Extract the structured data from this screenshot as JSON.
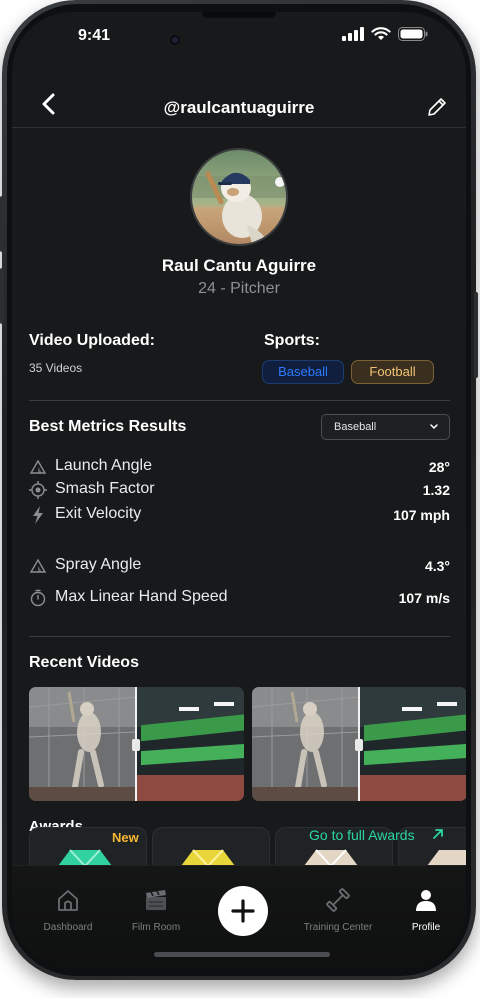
{
  "status_bar": {
    "time": "9:41"
  },
  "header": {
    "handle": "@raulcantuaguirre"
  },
  "profile": {
    "name": "Raul Cantu Aguirre",
    "subtitle": "24 - Pitcher"
  },
  "videos": {
    "label": "Video Uploaded:",
    "count": "35 Videos"
  },
  "sports": {
    "label": "Sports:",
    "tags": [
      "Baseball",
      "Football"
    ]
  },
  "metrics": {
    "title": "Best Metrics Results",
    "filter": "Baseball",
    "items": [
      {
        "label": "Launch Angle",
        "value": "28°",
        "icon": "triangle-icon"
      },
      {
        "label": "Smash Factor",
        "value": "1.32",
        "icon": "target-icon"
      },
      {
        "label": "Exit Velocity",
        "value": "107 mph",
        "icon": "bolt-icon"
      },
      {
        "label": "Spray Angle",
        "value": "4.3°",
        "icon": "triangle-icon"
      },
      {
        "label": "Max Linear Hand Speed",
        "value": "107 m/s",
        "icon": "stopwatch-icon"
      }
    ]
  },
  "recent_videos": {
    "title": "Recent Videos"
  },
  "awards": {
    "label": "Awards",
    "link": "Go to full Awards",
    "new_badge": "New"
  },
  "tabbar": {
    "items": [
      {
        "label": "Dashboard",
        "icon": "house-icon"
      },
      {
        "label": "Film Room",
        "icon": "clapperboard-icon"
      },
      {
        "label": "Training Center",
        "icon": "dumbbell-icon"
      },
      {
        "label": "Profile",
        "icon": "user-icon"
      }
    ]
  },
  "colors": {
    "accent_green": "#2bd6a0",
    "baseball_blue": "#2e7bff",
    "football_gold": "#f1c374",
    "new_badge": "#f7b731"
  }
}
